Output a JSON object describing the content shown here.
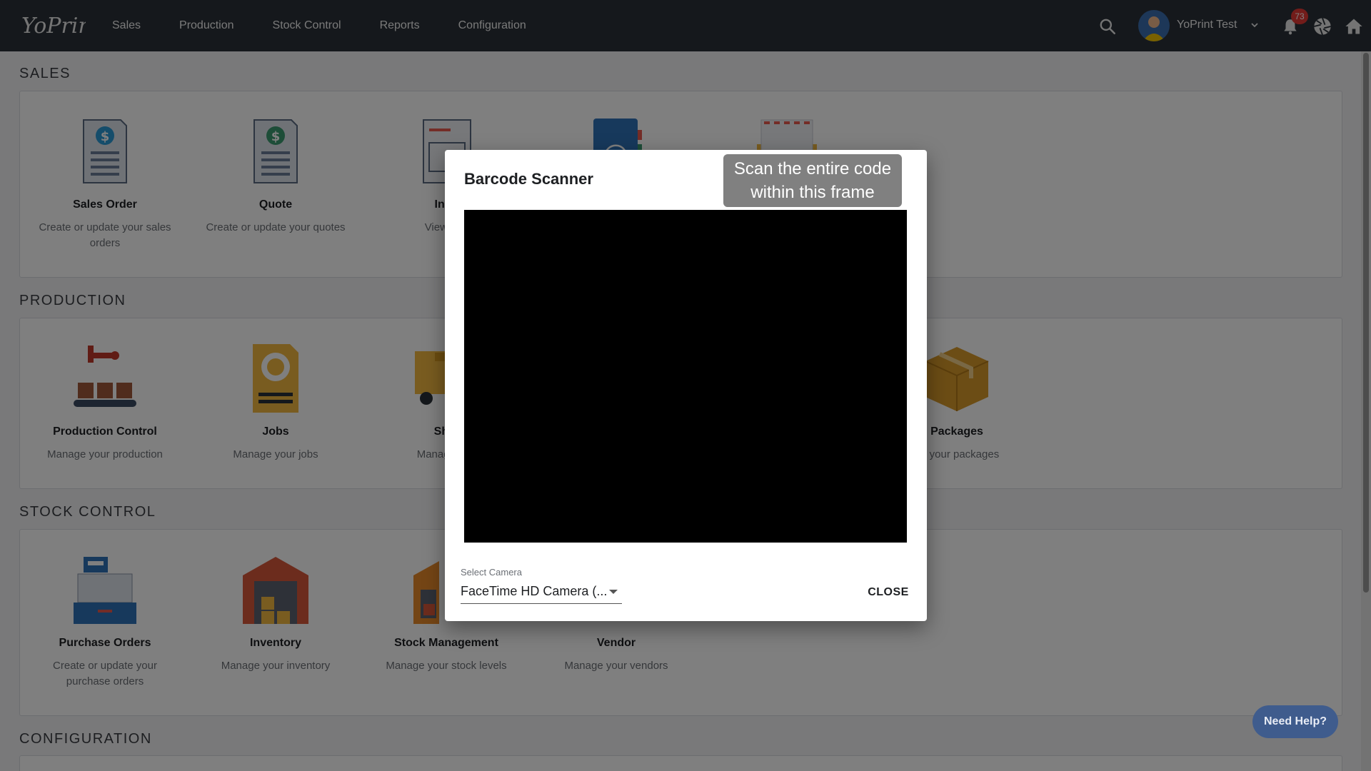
{
  "app": {
    "logo_text": "YoPrint"
  },
  "nav": [
    "Sales",
    "Production",
    "Stock Control",
    "Reports",
    "Configuration"
  ],
  "user": {
    "name": "YoPrint Test",
    "notifications": "73"
  },
  "sections": {
    "sales": {
      "title": "SALES",
      "tiles": [
        {
          "title": "Sales Order",
          "desc": "Create or update your sales orders",
          "icon": "sales-order-icon"
        },
        {
          "title": "Quote",
          "desc": "Create or update your quotes",
          "icon": "quote-icon"
        },
        {
          "title": "Invo",
          "desc": "View you",
          "icon": "invoice-icon"
        },
        {
          "title": "",
          "desc": "",
          "icon": "contacts-book-icon"
        },
        {
          "title": "",
          "desc": "",
          "icon": "mail-envelope-icon"
        }
      ]
    },
    "production": {
      "title": "PRODUCTION",
      "tiles": [
        {
          "title": "Production Control",
          "desc": "Manage your production",
          "icon": "production-control-icon"
        },
        {
          "title": "Jobs",
          "desc": "Manage your jobs",
          "icon": "jobs-icon"
        },
        {
          "title": "Ship",
          "desc": "Manage you",
          "icon": "shipping-truck-icon"
        },
        {
          "title": "Packages",
          "desc": "ge your packages",
          "icon": "package-box-icon"
        }
      ]
    },
    "stock": {
      "title": "STOCK CONTROL",
      "tiles": [
        {
          "title": "Purchase Orders",
          "desc": "Create or update your purchase orders",
          "icon": "cash-register-icon"
        },
        {
          "title": "Inventory",
          "desc": "Manage your inventory",
          "icon": "warehouse-icon"
        },
        {
          "title": "Stock Management",
          "desc": "Manage your stock levels",
          "icon": "stock-warehouse-icon"
        },
        {
          "title": "Vendor",
          "desc": "Manage your vendors",
          "icon": "vendor-icon"
        }
      ]
    },
    "configuration": {
      "title": "CONFIGURATION"
    }
  },
  "dialog": {
    "title": "Barcode Scanner",
    "scan_hint": "Scan the entire code within this frame",
    "camera_label": "Select Camera",
    "camera_value": "FaceTime HD Camera (...",
    "close_label": "CLOSE"
  },
  "help": {
    "label": "Need Help?"
  },
  "colors": {
    "topbar": "#2a3139",
    "help_button": "#3f5c8d",
    "badge": "#e53935"
  }
}
